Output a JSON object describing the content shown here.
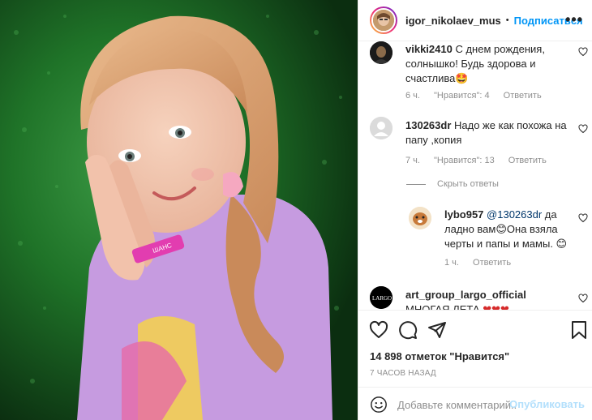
{
  "header": {
    "username": "igor_nikolaev_mus",
    "dot": "•",
    "follow_label": "Подписаться",
    "more_label": "•••"
  },
  "comments": [
    {
      "username": "vikki2410",
      "text": "С днем рождения, солнышко! Будь здорова и счастлива🤩",
      "time": "6 ч.",
      "likes": "\"Нравится\": 4",
      "reply": "Ответить"
    },
    {
      "username": "130263dr",
      "text": "Надо же как похожа на папу ,копия",
      "time": "7 ч.",
      "likes": "\"Нравится\": 13",
      "reply": "Ответить"
    },
    {
      "username": "lybo957",
      "mention": "@130263dr",
      "text_before": " да ладно вам",
      "text_after": "Она взяла черты и папы и мамы. ",
      "time": "1 ч.",
      "reply": "Ответить"
    },
    {
      "username": "art_group_largo_official",
      "text": "МНОГАЯ ЛЕТА"
    }
  ],
  "hide_replies": "Скрыть ответы",
  "likes_count": "14 898 отметок \"Нравится\"",
  "post_time": "7 ЧАСОВ НАЗАД",
  "add_comment": {
    "placeholder": "Добавьте комментарий...",
    "post_label": "Опубликовать"
  },
  "largo_logo_text": "LARGO",
  "wristband_text": "ШАНС"
}
